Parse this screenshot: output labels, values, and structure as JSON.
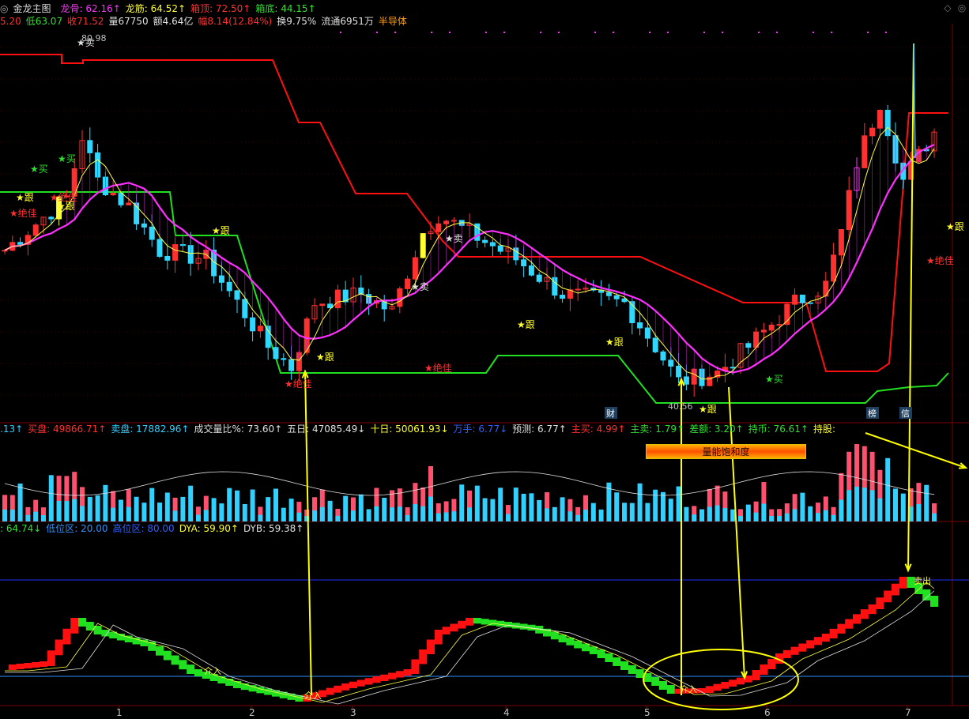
{
  "header": {
    "window_icon": "circle-icon",
    "title": "金龙主图",
    "indicators": [
      {
        "label": "龙骨: 62.16",
        "arrow": "↑",
        "color": "#ff30ff"
      },
      {
        "label": "龙筋: 64.52",
        "arrow": "↑",
        "color": "#ffff30"
      },
      {
        "label": "箱顶: 72.50",
        "arrow": "↑",
        "color": "#ff3030"
      },
      {
        "label": "箱底: 44.15",
        "arrow": "↑",
        "color": "#30e030"
      }
    ]
  },
  "quote": [
    {
      "text": "5.20",
      "color": "#ff3030"
    },
    {
      "text": "低63.07",
      "color": "#30e030"
    },
    {
      "text": "收71.52",
      "color": "#ff3030"
    },
    {
      "text": "量67750",
      "color": "#e0e0e0"
    },
    {
      "text": "额4.64亿",
      "color": "#e0e0e0"
    },
    {
      "text": "幅8.14(12.84%)",
      "color": "#ff3030"
    },
    {
      "text": "换9.75%",
      "color": "#e0e0e0"
    },
    {
      "text": "流通6951万",
      "color": "#e0e0e0"
    },
    {
      "text": "半导体",
      "color": "#ffa020"
    }
  ],
  "volume_panel": [
    {
      "label": ".13",
      "arrow": "↑",
      "color": "#30d0ff"
    },
    {
      "label": "买盘: 49866.71",
      "arrow": "↑",
      "color": "#ff3030"
    },
    {
      "label": "卖盘: 17882.96",
      "arrow": "↑",
      "color": "#30d0ff"
    },
    {
      "label": "成交量比%: 73.60",
      "arrow": "↑",
      "color": "#e0e0e0"
    },
    {
      "label": "五日: 47085.49",
      "arrow": "↓",
      "color": "#e0e0e0"
    },
    {
      "label": "十日: 50061.93",
      "arrow": "↓",
      "color": "#ffff30"
    },
    {
      "label": "万手: 6.77",
      "arrow": "↓",
      "color": "#3060ff"
    },
    {
      "label": "预测: 6.77",
      "arrow": "↑",
      "color": "#e0e0e0"
    },
    {
      "label": "主买: 4.99",
      "arrow": "↑",
      "color": "#ff3030"
    },
    {
      "label": "主卖: 1.79",
      "arrow": "↑",
      "color": "#30e030"
    },
    {
      "label": "差额: 3.20",
      "arrow": "↑",
      "color": "#30e030"
    },
    {
      "label": "持币: 76.61",
      "arrow": "↑",
      "color": "#30e030"
    },
    {
      "label": "持股:",
      "arrow": "",
      "color": "#ffff30"
    }
  ],
  "osc_panel": [
    {
      "label": ": 64.74",
      "arrow": "↓",
      "color": "#30e030"
    },
    {
      "label": "低位区: 20.00",
      "arrow": "",
      "color": "#3090ff"
    },
    {
      "label": "高位区: 80.00",
      "arrow": "",
      "color": "#3060ff"
    },
    {
      "label": "DYA: 59.90",
      "arrow": "↑",
      "color": "#ffff30"
    },
    {
      "label": "DYB: 59.38",
      "arrow": "↑",
      "color": "#e0e0e0"
    }
  ],
  "banner": "量能饱和度",
  "price_labels": {
    "high": "80.98",
    "low": "40.56"
  },
  "markers": [
    {
      "text": "★卖",
      "color": "#e0e0e0",
      "x": 97,
      "y": 58
    },
    {
      "text": "★买",
      "color": "#30e030",
      "x": 73,
      "y": 205
    },
    {
      "text": "★买",
      "color": "#30e030",
      "x": 38,
      "y": 218
    },
    {
      "text": "★跟",
      "color": "#ffff30",
      "x": 20,
      "y": 254
    },
    {
      "text": "★绝佳",
      "color": "#ff3030",
      "x": 12,
      "y": 274
    },
    {
      "text": "★绝佳",
      "color": "#ff3030",
      "x": 63,
      "y": 254
    },
    {
      "text": "★跟",
      "color": "#ffff30",
      "x": 72,
      "y": 265
    },
    {
      "text": "★跟",
      "color": "#ffff30",
      "x": 268,
      "y": 296
    },
    {
      "text": "★卖",
      "color": "#e0e0e0",
      "x": 563,
      "y": 306
    },
    {
      "text": "★卖",
      "color": "#e0e0e0",
      "x": 520,
      "y": 367
    },
    {
      "text": "★跟",
      "color": "#ffff30",
      "x": 654,
      "y": 415
    },
    {
      "text": "★跟",
      "color": "#ffff30",
      "x": 400,
      "y": 456
    },
    {
      "text": "★绝佳",
      "color": "#ff3030",
      "x": 537,
      "y": 470
    },
    {
      "text": "★绝佳",
      "color": "#ff3030",
      "x": 360,
      "y": 490
    },
    {
      "text": "★跟",
      "color": "#ffff30",
      "x": 766,
      "y": 437
    },
    {
      "text": "★买",
      "color": "#30e030",
      "x": 968,
      "y": 484
    },
    {
      "text": "★跟",
      "color": "#ffff30",
      "x": 1197,
      "y": 291
    },
    {
      "text": "★绝佳",
      "color": "#ff3030",
      "x": 1172,
      "y": 334
    },
    {
      "text": "★跟",
      "color": "#ffff30",
      "x": 884,
      "y": 522
    }
  ],
  "tags": [
    {
      "text": "财",
      "x": 767,
      "y": 527
    },
    {
      "text": "榜",
      "x": 1098,
      "y": 527
    },
    {
      "text": "信",
      "x": 1140,
      "y": 527
    }
  ],
  "osc_labels": [
    {
      "text": "介入",
      "x": 258,
      "y": 853
    },
    {
      "text": "介入",
      "x": 385,
      "y": 884
    },
    {
      "text": "介入",
      "x": 860,
      "y": 876
    },
    {
      "text": "卖出",
      "x": 1156,
      "y": 739
    }
  ],
  "x_ticks": [
    {
      "label": "1",
      "x": 150
    },
    {
      "label": "2",
      "x": 318
    },
    {
      "label": "3",
      "x": 446
    },
    {
      "label": "4",
      "x": 640
    },
    {
      "label": "5",
      "x": 818
    },
    {
      "label": "6",
      "x": 970
    },
    {
      "label": "7",
      "x": 1148
    }
  ],
  "colors": {
    "up": "#ff3030",
    "down": "#30d8ff",
    "box_top": "#ff1010",
    "box_bottom": "#20e020",
    "ma_pink": "#ff30ff",
    "ma_yellow": "#ffff40",
    "annotation": "#ffff00"
  }
}
